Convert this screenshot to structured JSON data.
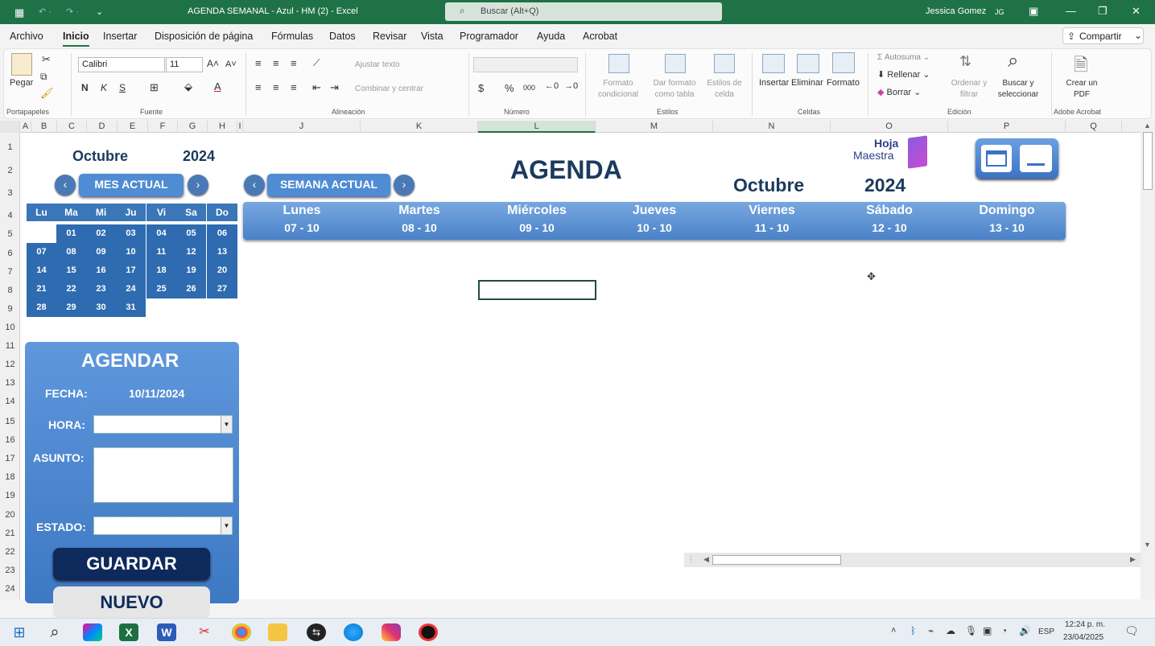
{
  "titlebar": {
    "doc_title": "AGENDA SEMANAL - Azul  -  HM (2)  -  Excel",
    "search_placeholder": "Buscar (Alt+Q)",
    "user_name": "Jessica Gomez",
    "user_initials": "JG"
  },
  "menu": {
    "items": [
      "Archivo",
      "Inicio",
      "Insertar",
      "Disposición de página",
      "Fórmulas",
      "Datos",
      "Revisar",
      "Vista",
      "Programador",
      "Ayuda",
      "Acrobat"
    ],
    "share_label": "Compartir"
  },
  "ribbon": {
    "clipboard": {
      "paste": "Pegar",
      "group": "Portapapeles"
    },
    "font": {
      "name": "Calibri",
      "size": "11",
      "bold": "N",
      "italic": "K",
      "underline": "S",
      "group": "Fuente"
    },
    "alignment": {
      "wrap": "Ajustar texto",
      "merge": "Combinar y centrar",
      "group": "Alineación"
    },
    "number": {
      "currency": "$",
      "percent": "%",
      "thousands": "000",
      "group": "Número"
    },
    "styles": {
      "conditional": "Formato condicional",
      "as_table": "Dar formato como tabla",
      "cell_styles": "Estilos de celda",
      "group": "Estilos"
    },
    "cells": {
      "insert": "Insertar",
      "delete": "Eliminar",
      "format": "Formato",
      "group": "Celdas"
    },
    "editing": {
      "autosum": "Autosuma",
      "fill": "Rellenar",
      "clear": "Borrar",
      "sort": "Ordenar y filtrar",
      "find": "Buscar y seleccionar",
      "group": "Edición"
    },
    "acrobat": {
      "create_pdf": "Crear un PDF",
      "group": "Adobe Acrobat"
    }
  },
  "columns": [
    "A",
    "B",
    "C",
    "D",
    "E",
    "F",
    "G",
    "H",
    "I",
    "J",
    "K",
    "L",
    "M",
    "N",
    "O",
    "P",
    "Q"
  ],
  "rows": [
    "1",
    "2",
    "3",
    "4",
    "5",
    "6",
    "7",
    "8",
    "9",
    "10",
    "11",
    "12",
    "13",
    "14",
    "15",
    "16",
    "17",
    "18",
    "19",
    "20",
    "21",
    "22",
    "23",
    "24"
  ],
  "mini_calendar": {
    "month": "Octubre",
    "year": "2024",
    "button_label": "MES ACTUAL",
    "weekdays": [
      "Lu",
      "Ma",
      "Mi",
      "Ju",
      "Vi",
      "Sa",
      "Do"
    ],
    "weeks": [
      [
        "",
        "01",
        "02",
        "03",
        "04",
        "05",
        "06"
      ],
      [
        "07",
        "08",
        "09",
        "10",
        "11",
        "12",
        "13"
      ],
      [
        "14",
        "15",
        "16",
        "17",
        "18",
        "19",
        "20"
      ],
      [
        "21",
        "22",
        "23",
        "24",
        "25",
        "26",
        "27"
      ],
      [
        "28",
        "29",
        "30",
        "31",
        "",
        "",
        ""
      ]
    ]
  },
  "week_nav": {
    "button_label": "SEMANA ACTUAL"
  },
  "header": {
    "title": "AGENDA",
    "month": "Octubre",
    "year": "2024",
    "logo_line1": "Hoja",
    "logo_line2": "Maestra"
  },
  "week_days": [
    {
      "name": "Lunes",
      "date": "07 - 10"
    },
    {
      "name": "Martes",
      "date": "08 - 10"
    },
    {
      "name": "Miércoles",
      "date": "09 - 10"
    },
    {
      "name": "Jueves",
      "date": "10 - 10"
    },
    {
      "name": "Viernes",
      "date": "11 - 10"
    },
    {
      "name": "Sábado",
      "date": "12 - 10"
    },
    {
      "name": "Domingo",
      "date": "13 - 10"
    }
  ],
  "agendar": {
    "title": "AGENDAR",
    "fecha_label": "FECHA:",
    "fecha_value": "10/11/2024",
    "hora_label": "HORA:",
    "asunto_label": "ASUNTO:",
    "estado_label": "ESTADO:",
    "save_label": "GUARDAR",
    "new_label": "NUEVO"
  },
  "taskbar": {
    "lang": "ESP",
    "time": "12:24 p. m.",
    "date": "23/04/2025"
  },
  "colors": {
    "excel_green": "#1f7246",
    "agenda_blue": "#2e6bb0",
    "title_navy": "#1b3a5c"
  }
}
